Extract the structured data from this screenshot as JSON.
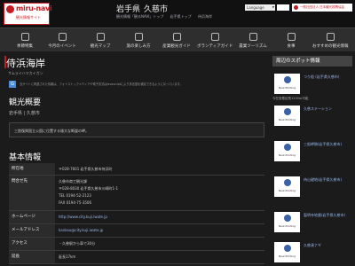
{
  "header": {
    "logo_text": "miru-navi",
    "logo_sub": "観光情報サイト",
    "pref": "岩手県",
    "city": "久慈市",
    "breadcrumb": [
      "観光情報「観るNAVI」トップ",
      "岩手県トップ",
      "侍浜海岸"
    ],
    "language_label": "Language",
    "jnto_label": "一般社団法人 日本観光振興協会"
  },
  "nav": [
    {
      "label": "季節特集",
      "icon": "leaf-icon"
    },
    {
      "label": "今月のイベント",
      "icon": "calendar-icon"
    },
    {
      "label": "観光マップ",
      "icon": "map-icon"
    },
    {
      "label": "旅の楽しみ方",
      "icon": "suitcase-icon"
    },
    {
      "label": "産業観光ガイド",
      "icon": "factory-icon"
    },
    {
      "label": "ボランティアガイド",
      "icon": "guide-icon"
    },
    {
      "label": "農業ツーリズム",
      "icon": "farm-icon"
    },
    {
      "label": "食事",
      "icon": "food-icon"
    },
    {
      "label": "おすすめの観光情報",
      "icon": "star-icon"
    }
  ],
  "spot": {
    "title": "侍浜海岸",
    "reading": "サムライハマカイガン",
    "translate_note": "当サイトに掲載された情報は、フォトストックメディアや電子書式はJavascriptにより多言語を補足できるようになっています。",
    "overview_heading": "観光概要",
    "location": "岩手県 | 久慈市",
    "description": "三陸復興国立公園に位置する雄大な断崖の岬。"
  },
  "basic": {
    "heading": "基本情報",
    "rows": [
      {
        "key": "所在地",
        "values": [
          "〒028-7601 岩手県久慈市侍浜町"
        ]
      },
      {
        "key": "問合せ先",
        "values": [
          "久慈市商工観光課",
          "〒028-8030 岩手県久慈市川崎町1-1",
          "TEL 0194-52-2123",
          "FAX 0194-75-3506"
        ]
      },
      {
        "key": "ホームページ",
        "values": [
          "http://www.city.kuji.iwate.jp"
        ],
        "link": true
      },
      {
        "key": "メールアドレス",
        "values": [
          "kankou@city.kuji.iwate.jp"
        ],
        "link": true
      },
      {
        "key": "アクセス",
        "values": [
          "・久慈駅から車で30分"
        ]
      },
      {
        "key": "延長",
        "values": [
          "延長17km"
        ]
      }
    ]
  },
  "sidebar": {
    "title": "周辺のスポット情報",
    "thumb_text": "Now Printing",
    "spots": [
      {
        "name": "つり船 (岩手県久慈市)",
        "sub": "今在宮基延長1200m可能"
      },
      {
        "name": "久慈ステーション"
      },
      {
        "name": "三船岬跡(岩手県久慈市)"
      },
      {
        "name": "侍山礎地(岩手県久慈市)"
      },
      {
        "name": "聖明寺地層(岩手県久慈市)"
      },
      {
        "name": "久慈湊ナギ"
      }
    ]
  }
}
